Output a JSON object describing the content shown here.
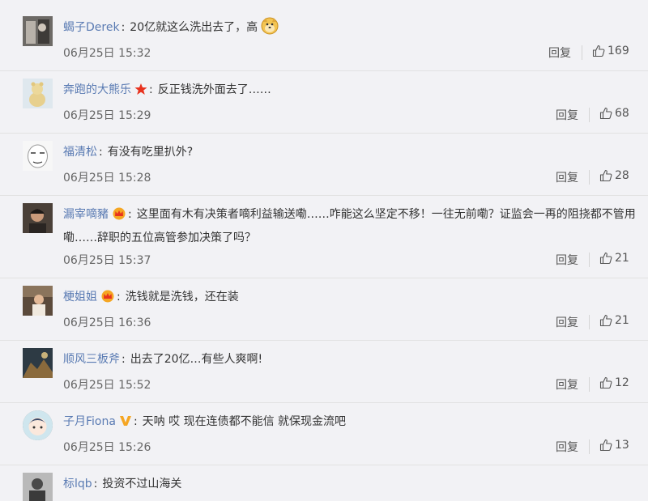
{
  "comments": [
    {
      "user": "蝎子Derek",
      "text": "20亿就这么洗出去了，高",
      "time": "06月25日 15:32",
      "reply_label": "回复",
      "likes": "169"
    },
    {
      "user": "奔跑的大熊乐",
      "text": "反正钱洗外面去了……",
      "time": "06月25日 15:29",
      "reply_label": "回复",
      "likes": "68"
    },
    {
      "user": "福清松",
      "text": "有没有吃里扒外?",
      "time": "06月25日 15:28",
      "reply_label": "回复",
      "likes": "28"
    },
    {
      "user": "漏宰嘀豬",
      "text": "这里面有木有决策者嘀利益输送嘞……咋能这么坚定不移！一往无前嘞？证监会一再的阻挠都不管用嘞……辞职的五位高管参加决策了吗？",
      "time": "06月25日 15:37",
      "reply_label": "回复",
      "likes": "21"
    },
    {
      "user": "梗姐姐",
      "text": "洗钱就是洗钱，还在装",
      "time": "06月25日 16:36",
      "reply_label": "回复",
      "likes": "21"
    },
    {
      "user": "顺风三板斧",
      "text": "出去了20亿…有些人爽啊!",
      "time": "06月25日 15:52",
      "reply_label": "回复",
      "likes": "12"
    },
    {
      "user": "子月Fiona",
      "text": "天呐 哎 现在连债都不能信 就保现金流吧",
      "time": "06月25日 15:26",
      "reply_label": "回复",
      "likes": "13"
    },
    {
      "user": "标lqb",
      "text": "投资不过山海关"
    }
  ],
  "colors": {
    "background": "#f2f2f5",
    "username": "#5a7bb3",
    "text": "#333333",
    "meta": "#666666",
    "divider": "#e2e2e2"
  },
  "icons": [
    "thumbs-up-icon",
    "star-badge-icon",
    "crown-badge-icon",
    "vip-v-badge-icon",
    "doge-emoji-icon"
  ]
}
